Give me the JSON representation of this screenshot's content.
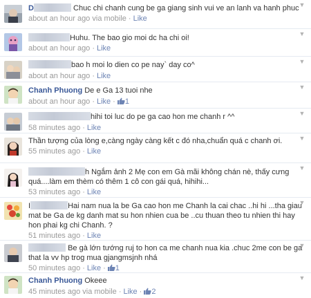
{
  "comments": [
    {
      "redacted_width": 54,
      "author": "",
      "text": "Chuc chi chanh cung be ga giang sinh vui ve an lanh va hanh phuc",
      "time": "about an hour ago",
      "via": "via mobile",
      "like": "Like",
      "likes": ""
    },
    {
      "redacted_width": 60,
      "author": "",
      "text": "Huhu. The bao gio moi dc ha chi oi!",
      "time": "about an hour ago",
      "via": "",
      "like": "Like",
      "likes": ""
    },
    {
      "redacted_width": 62,
      "author": "",
      "text": "bao h moi lo dien co pe nay` day co^",
      "time": "about an hour ago",
      "via": "",
      "like": "Like",
      "likes": ""
    },
    {
      "redacted_width": 0,
      "author": "Chanh Phuong",
      "text": "De e Ga 13 tuoi nhe",
      "time": "about an hour ago",
      "via": "",
      "like": "Like",
      "likes": "1"
    },
    {
      "redacted_width": 90,
      "author": "",
      "text": "hihi toi luc do pe ga cao hon me chanh r ^^",
      "time": "58 minutes ago",
      "via": "",
      "like": "Like",
      "likes": ""
    },
    {
      "redacted_width": 0,
      "author": "",
      "text": "Thần tượng của lòng e,càng ngày càng kết c đó nha,chuẩn quá c chanh ơi.",
      "time": "55 minutes ago",
      "via": "",
      "like": "Like",
      "likes": ""
    },
    {
      "redacted_width": 82,
      "author": "",
      "text": "h Ngắm ảnh 2 Mẹ con em Gà mãi không chán nè, thấy cưng quá....làm em thèm có thêm 1 cô con gái quá, hihihi...",
      "time": "53 minutes ago",
      "via": "",
      "like": "Like",
      "likes": ""
    },
    {
      "redacted_width": 54,
      "author": "",
      "text": "Hai nam nua la be Ga cao hon me Chanh la cai chac ..hi hi ...tha giau mat be Ga de kg danh mat su hon nhien cua be ..cu thuan theo tu nhien thi hay hon phai kg chi Chanh. ?",
      "time": "51 minutes ago",
      "via": "",
      "like": "Like",
      "likes": ""
    },
    {
      "redacted_width": 54,
      "author": "",
      "text": "Be gà lớn tướng ruj to hon ca me chanh nua kia .chuc 2me con be ga that la vv hp trog mua gjangmsjnh nhá",
      "time": "50 minutes ago",
      "via": "",
      "like": "Like",
      "likes": "1"
    },
    {
      "redacted_width": 0,
      "author": "Chanh Phuong",
      "text": "Okeee",
      "time": "45 minutes ago",
      "via": "via mobile",
      "like": "Like",
      "likes": "2"
    }
  ],
  "icons": {
    "chevron": "chevron-down-icon",
    "like": "thumbs-up-icon"
  },
  "colors": {
    "link": "#3b5998",
    "meta": "#999999",
    "like": "#6d84b4",
    "divider": "#e5eaf1"
  }
}
